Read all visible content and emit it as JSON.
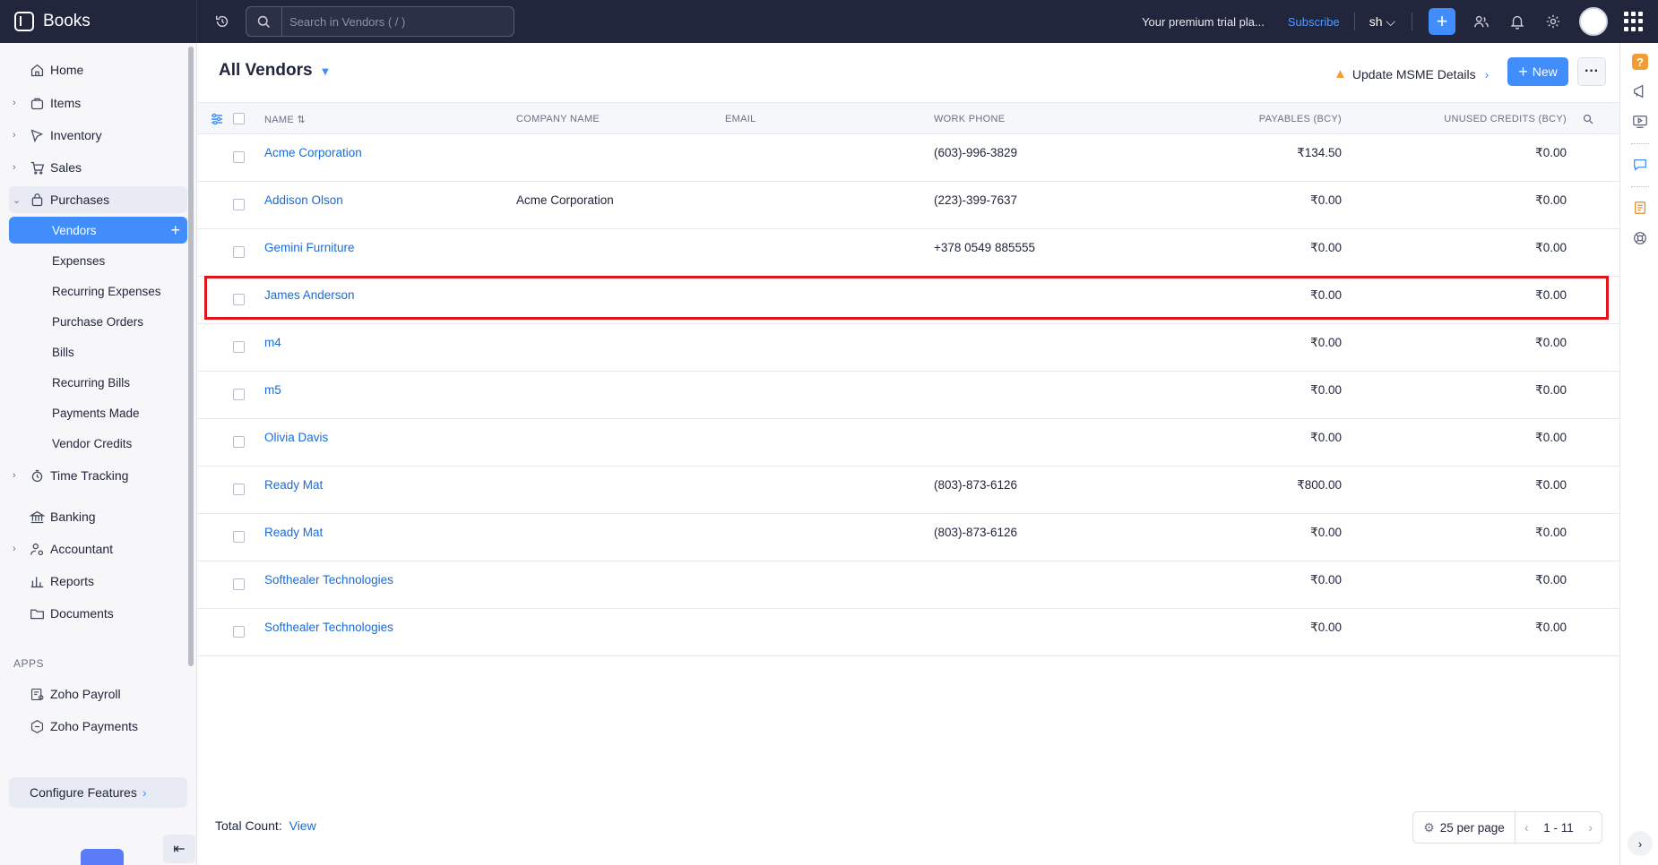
{
  "app": {
    "name": "Books"
  },
  "search": {
    "placeholder": "Search in Vendors ( / )"
  },
  "topbar": {
    "trial_text": "Your premium trial pla...",
    "subscribe": "Subscribe",
    "org": "sh",
    "org_caret": "⌵"
  },
  "sidebar": {
    "home": "Home",
    "items": "Items",
    "inventory": "Inventory",
    "sales": "Sales",
    "purchases": "Purchases",
    "vendors": "Vendors",
    "expenses": "Expenses",
    "recurring_expenses": "Recurring Expenses",
    "purchase_orders": "Purchase Orders",
    "bills": "Bills",
    "recurring_bills": "Recurring Bills",
    "payments_made": "Payments Made",
    "vendor_credits": "Vendor Credits",
    "time_tracking": "Time Tracking",
    "banking": "Banking",
    "accountant": "Accountant",
    "reports": "Reports",
    "documents": "Documents",
    "apps_label": "APPS",
    "zoho_payroll": "Zoho Payroll",
    "zoho_payments": "Zoho Payments",
    "configure": "Configure Features"
  },
  "main": {
    "title": "All Vendors",
    "msme": "Update MSME Details",
    "new_label": "New",
    "more_label": "···"
  },
  "table": {
    "headers": {
      "name": "NAME",
      "company": "COMPANY NAME",
      "email": "EMAIL",
      "work_phone": "WORK PHONE",
      "payables": "PAYABLES (BCY)",
      "unused_credits": "UNUSED CREDITS (BCY)"
    },
    "rows": [
      {
        "name": "Acme Corporation",
        "company": "",
        "email": "",
        "phone": "(603)-996-3829",
        "payables": "₹134.50",
        "credits": "₹0.00"
      },
      {
        "name": "Addison Olson",
        "company": "Acme Corporation",
        "email": "",
        "phone": "(223)-399-7637",
        "payables": "₹0.00",
        "credits": "₹0.00"
      },
      {
        "name": "Gemini Furniture",
        "company": "",
        "email": "",
        "phone": "+378 0549 885555",
        "payables": "₹0.00",
        "credits": "₹0.00"
      },
      {
        "name": "James Anderson",
        "company": "",
        "email": "",
        "phone": "",
        "payables": "₹0.00",
        "credits": "₹0.00"
      },
      {
        "name": "m4",
        "company": "",
        "email": "",
        "phone": "",
        "payables": "₹0.00",
        "credits": "₹0.00"
      },
      {
        "name": "m5",
        "company": "",
        "email": "",
        "phone": "",
        "payables": "₹0.00",
        "credits": "₹0.00"
      },
      {
        "name": "Olivia Davis",
        "company": "",
        "email": "",
        "phone": "",
        "payables": "₹0.00",
        "credits": "₹0.00"
      },
      {
        "name": "Ready Mat",
        "company": "",
        "email": "",
        "phone": "(803)-873-6126",
        "payables": "₹800.00",
        "credits": "₹0.00"
      },
      {
        "name": "Ready Mat",
        "company": "",
        "email": "",
        "phone": "(803)-873-6126",
        "payables": "₹0.00",
        "credits": "₹0.00"
      },
      {
        "name": "Softhealer Technologies",
        "company": "",
        "email": "",
        "phone": "",
        "payables": "₹0.00",
        "credits": "₹0.00"
      },
      {
        "name": "Softhealer Technologies",
        "company": "",
        "email": "",
        "phone": "",
        "payables": "₹0.00",
        "credits": "₹0.00"
      }
    ],
    "highlighted_row": "James Anderson"
  },
  "footer": {
    "total_count_label": "Total Count:",
    "view_link": "View",
    "per_page": "25 per page",
    "range": "1 - 11"
  },
  "colors": {
    "accent": "#408dfb",
    "topbar": "#21263c",
    "highlight": "#e1141c",
    "link": "#1a6bd8"
  }
}
